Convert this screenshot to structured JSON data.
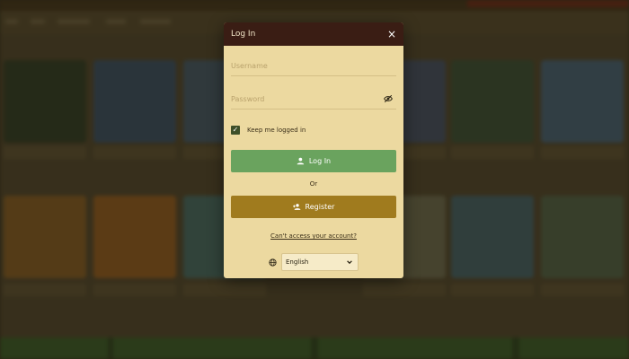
{
  "modal": {
    "title": "Log In",
    "close_label": "×",
    "username_placeholder": "Username",
    "password_placeholder": "Password",
    "remember_label": "Keep me logged in",
    "remember_checked": true,
    "login_label": "Log In",
    "or_label": "Or",
    "register_label": "Register",
    "forgot_link": "Can't access your account?",
    "language": {
      "selected": "English"
    }
  },
  "colors": {
    "header_bg": "#3a1d14",
    "modal_bg": "#ecd9a0",
    "login_button": "#6aa35e",
    "register_button": "#a07b1e",
    "checkbox": "#3e4f28"
  },
  "icons": {
    "close": "close-icon",
    "password_toggle": "eye-off-icon",
    "login": "user-icon",
    "register": "user-plus-icon",
    "language": "globe-icon",
    "select": "chevron-down-icon"
  }
}
